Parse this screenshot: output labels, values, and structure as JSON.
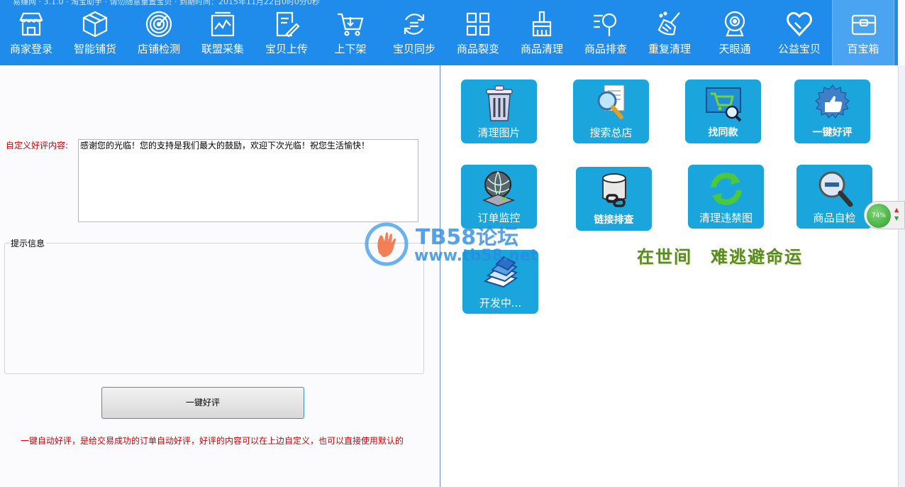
{
  "window": {
    "title_hint": "易赚网 · 3.1.0 · 淘宝助手 · 请勿随意重置宝贝 · 到期时间：2015年11月22日0时0分0秒",
    "minimize": "—",
    "close": "✕"
  },
  "toolbar": {
    "items": [
      {
        "label": "商家登录",
        "icon": "store-icon"
      },
      {
        "label": "智能铺货",
        "icon": "box-icon"
      },
      {
        "label": "店铺检测",
        "icon": "radar-icon"
      },
      {
        "label": "联盟采集",
        "icon": "chart-board-icon"
      },
      {
        "label": "宝贝上传",
        "icon": "upload-doc-icon"
      },
      {
        "label": "上下架",
        "icon": "cart-icon"
      },
      {
        "label": "宝贝同步",
        "icon": "sync-icon"
      },
      {
        "label": "商品裂变",
        "icon": "grid-icon"
      },
      {
        "label": "商品清理",
        "icon": "brush-icon"
      },
      {
        "label": "商品排查",
        "icon": "filter-search-icon"
      },
      {
        "label": "重复清理",
        "icon": "broom-icon"
      },
      {
        "label": "天眼通",
        "icon": "camera-icon"
      },
      {
        "label": "公益宝贝",
        "icon": "heart-icon"
      },
      {
        "label": "百宝箱",
        "icon": "wallet-icon"
      }
    ],
    "active_index": 13
  },
  "review_form": {
    "label": "自定义好评内容:",
    "content": "感谢您的光临！您的支持是我们最大的鼓励，欢迎下次光临！祝您生活愉快！",
    "info_group_title": "提示信息",
    "button_label": "一键好评",
    "note": "一键自动好评，是给交易成功的订单自动好评，好评的内容可以在上边自定义，也可以直接使用默认的"
  },
  "tools": [
    {
      "label": "清理图片",
      "icon": "trash-icon"
    },
    {
      "label": "搜索总店",
      "icon": "doc-search-icon"
    },
    {
      "label": "找同款",
      "icon": "cart-search-icon"
    },
    {
      "label": "一键好评",
      "icon": "thumbs-up-icon"
    },
    {
      "label": "订单监控",
      "icon": "satellite-icon"
    },
    {
      "label": "链接排查",
      "icon": "database-link-icon"
    },
    {
      "label": "清理违禁图",
      "icon": "refresh-icon"
    },
    {
      "label": "商品自检",
      "icon": "zoom-out-icon"
    },
    {
      "label": "开发中...",
      "icon": "stack-papers-icon"
    }
  ],
  "slogan": "在世间　难逃避命运",
  "watermark": {
    "line1": "TB58论坛",
    "line2": "www.tb58.net"
  },
  "net_widget": {
    "percent": "74%"
  },
  "colors": {
    "toolbar_bg": "#1f8bea",
    "tile_bg": "#1aa6dc",
    "red_text": "#d40000",
    "slogan": "#5a8a22"
  }
}
